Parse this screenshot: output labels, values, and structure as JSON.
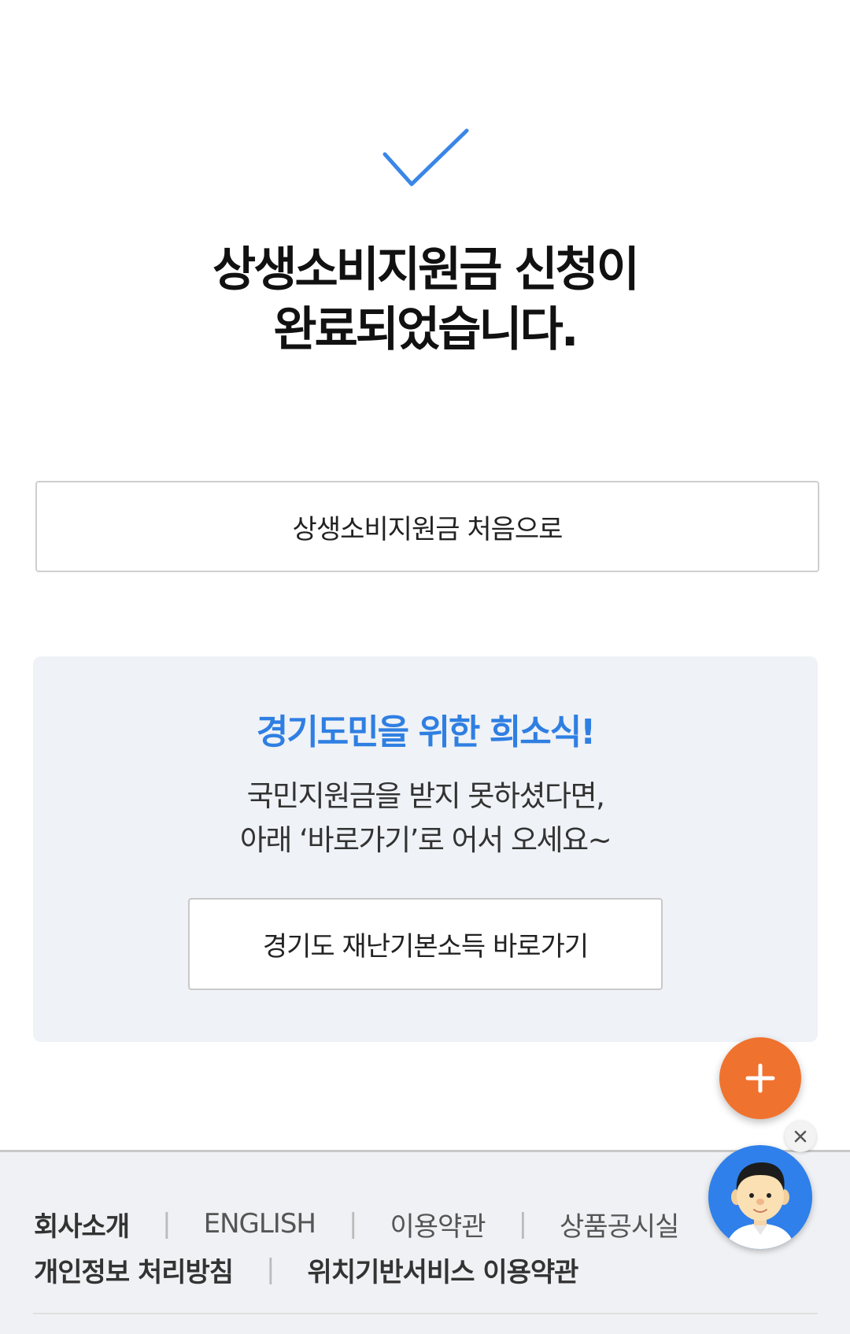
{
  "result": {
    "title_line1": "상생소비지원금 신청이",
    "title_line2": "완료되었습니다."
  },
  "home_button": {
    "label": "상생소비지원금 처음으로"
  },
  "notice": {
    "title": "경기도민을 위한 희소식!",
    "desc_line1": "국민지원금을 받지 못하셨다면,",
    "desc_line2": "아래 ‘바로가기’로 어서 오세요~",
    "button_label": "경기도 재난기본소득 바로가기"
  },
  "fab": {
    "icon": "plus-icon",
    "color": "#f0722f"
  },
  "chatbot": {
    "icon": "chatbot-avatar-icon",
    "close_icon": "close-icon"
  },
  "footer": {
    "row1": [
      "회사소개",
      "ENGLISH",
      "이용약관",
      "상품공시실"
    ],
    "row2": [
      "개인정보 처리방침",
      "위치기반서비스 이용약관"
    ]
  },
  "colors": {
    "accent_blue": "#2f7fe2",
    "check_blue": "#3a86e8",
    "notice_bg": "#eff2f6"
  }
}
